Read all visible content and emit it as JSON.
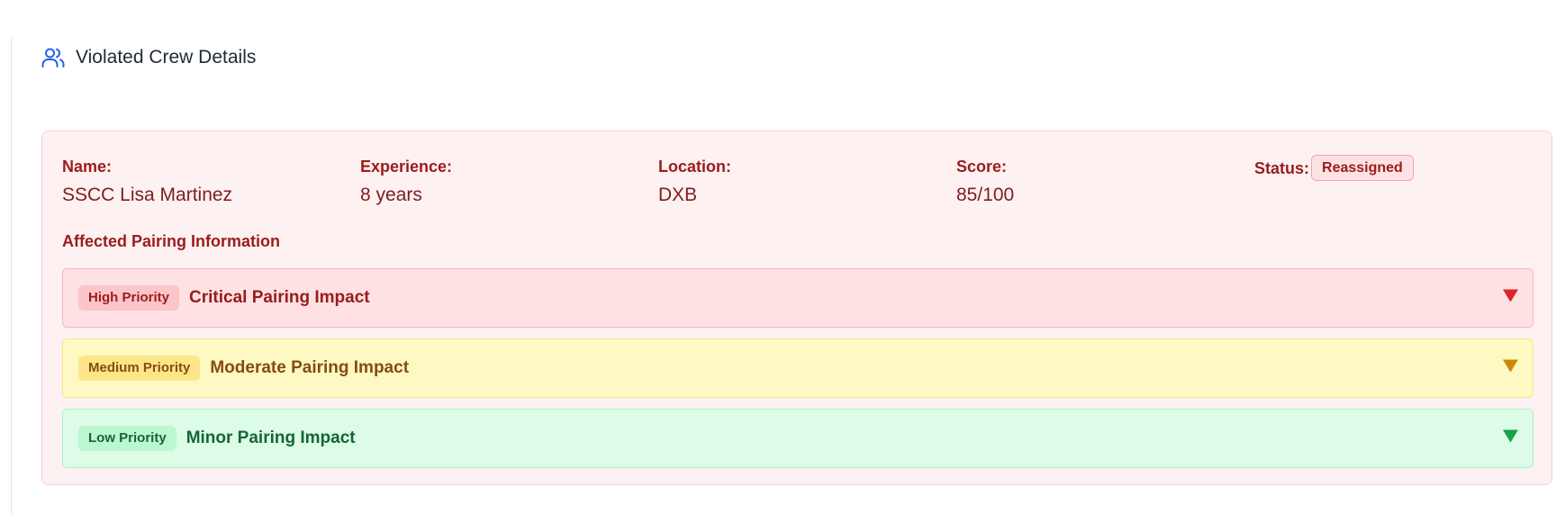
{
  "section": {
    "title": "Violated Crew Details",
    "icon": "users-icon"
  },
  "crew": {
    "fields": [
      {
        "label": "Name:",
        "value": "SSCC Lisa Martinez"
      },
      {
        "label": "Experience:",
        "value": "8 years"
      },
      {
        "label": "Location:",
        "value": "DXB"
      },
      {
        "label": "Score:",
        "value": "85/100"
      }
    ],
    "status": {
      "label": "Status:",
      "value": "Reassigned"
    }
  },
  "pairing": {
    "heading": "Affected Pairing Information",
    "items": [
      {
        "priority": "High Priority",
        "title": "Critical Pairing Impact",
        "color": "#dc2626",
        "icon": "chevron-down-icon"
      },
      {
        "priority": "Medium Priority",
        "title": "Moderate Pairing Impact",
        "color": "#ca8a04",
        "icon": "chevron-down-icon"
      },
      {
        "priority": "Low Priority",
        "title": "Minor Pairing Impact",
        "color": "#16a34a",
        "icon": "chevron-down-icon"
      }
    ]
  },
  "colors": {
    "accent_blue": "#2563eb",
    "danger_text": "#9b1c1c",
    "card_bg": "#fef1f2"
  }
}
